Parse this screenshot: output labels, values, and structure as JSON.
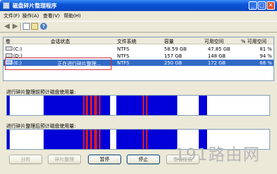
{
  "window": {
    "title": "磁盘碎片整理程序",
    "min": "_",
    "max": "□",
    "close": "✕"
  },
  "menu": [
    "文件(F)",
    "操作(A)",
    "查看(V)",
    "帮助(H)"
  ],
  "columns": [
    "卷",
    "会话状态",
    "文件系统",
    "容量",
    "可用空间",
    "% 可用空间"
  ],
  "volumes": [
    {
      "name": "(C:)",
      "status": "",
      "fs": "NTFS",
      "capacity": "58.59 GB",
      "free": "47.85 GB",
      "pct": "81 %",
      "selected": false
    },
    {
      "name": "(D:)",
      "status": "",
      "fs": "NTFS",
      "capacity": "157 GB",
      "free": "148 GB",
      "pct": "94 %",
      "selected": false
    },
    {
      "name": "(E:)",
      "status": "正在进行碎片整理...",
      "fs": "NTFS",
      "capacity": "250 GB",
      "free": "172 GB",
      "pct": "68 %",
      "selected": true
    }
  ],
  "before_label": "进行碎片整理前预计磁盘使用量:",
  "after_label": "进行碎片整理后预计磁盘使用量:",
  "buttons": {
    "analyze": "分析",
    "defrag": "碎片整理",
    "pause": "暂停",
    "stop": "停止",
    "report": "查看报告"
  },
  "colors": {
    "used": "#0000d8",
    "fragmented": "#e01818",
    "system": "#18a818",
    "free": "#ffffff"
  },
  "watermark": "191路由网"
}
